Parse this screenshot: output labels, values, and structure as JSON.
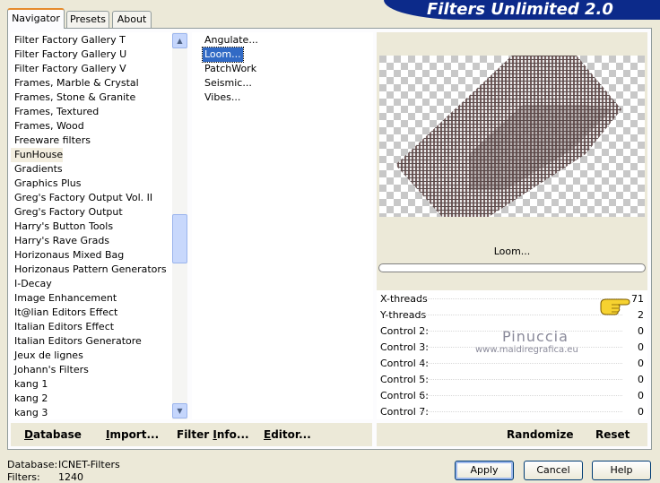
{
  "tabs": [
    "Navigator",
    "Presets",
    "About"
  ],
  "active_tab": "Navigator",
  "banner_title": "Filters Unlimited 2.0",
  "categories": [
    "Filter Factory Gallery T",
    "Filter Factory Gallery U",
    "Filter Factory Gallery V",
    "Frames, Marble & Crystal",
    "Frames, Stone & Granite",
    "Frames, Textured",
    "Frames, Wood",
    "Freeware filters",
    "FunHouse",
    "Gradients",
    "Graphics Plus",
    "Greg's Factory Output Vol. II",
    "Greg's Factory Output",
    "Harry's Button Tools",
    "Harry's Rave Grads",
    "Horizonaus Mixed Bag",
    "Horizonaus Pattern Generators",
    "I-Decay",
    "Image Enhancement",
    "It@lian Editors Effect",
    "Italian Editors Effect",
    "Italian Editors Generatore",
    "Jeux de lignes",
    "Johann's Filters",
    "kang 1",
    "kang 2",
    "kang 3"
  ],
  "selected_category": "FunHouse",
  "filters": [
    "Angulate...",
    "Loom...",
    "PatchWork",
    "Seismic...",
    "Vibes..."
  ],
  "selected_filter": "Loom...",
  "filter_name": "Loom...",
  "controls": [
    {
      "label": "X-threads",
      "value": "71"
    },
    {
      "label": "Y-threads",
      "value": "2"
    },
    {
      "label": "Control 2:",
      "value": "0"
    },
    {
      "label": "Control 3:",
      "value": "0"
    },
    {
      "label": "Control 4:",
      "value": "0"
    },
    {
      "label": "Control 5:",
      "value": "0"
    },
    {
      "label": "Control 6:",
      "value": "0"
    },
    {
      "label": "Control 7:",
      "value": "0"
    }
  ],
  "watermark": {
    "name": "Pinuccia",
    "site": "www.maidiregrafica.eu"
  },
  "bottom_buttons": {
    "database_prefix": "",
    "database_ul": "D",
    "database_rest": "atabase",
    "import_prefix": "",
    "import_ul": "I",
    "import_rest": "mport...",
    "filterinfo_prefix": "Filter ",
    "filterinfo_ul": "I",
    "filterinfo_rest": "nfo...",
    "editor_prefix": "",
    "editor_ul": "E",
    "editor_rest": "ditor...",
    "randomize": "Randomize",
    "reset": "Reset"
  },
  "status": {
    "database_label": "Database:",
    "database_value": "ICNET-Filters",
    "filters_label": "Filters:",
    "filters_value": "1240"
  },
  "dialog_buttons": {
    "apply": "Apply",
    "cancel": "Cancel",
    "help": "Help"
  }
}
